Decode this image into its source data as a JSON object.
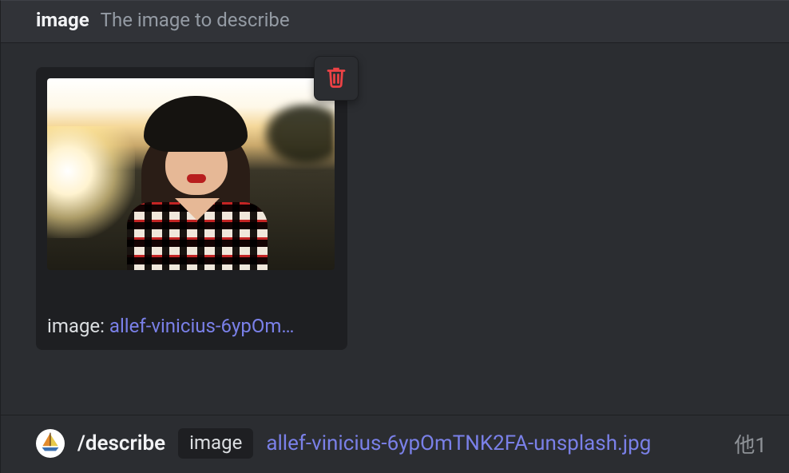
{
  "header": {
    "param_name": "image",
    "param_desc": "The image to describe"
  },
  "attachment": {
    "label_prefix": "image: ",
    "filename_truncated": "allef-vinicius-6ypOm…"
  },
  "input": {
    "command": "/describe",
    "param_chip": "image",
    "file_value": "allef-vinicius-6ypOmTNK2FA-unsplash.jpg",
    "trailing": "他1"
  },
  "icons": {
    "trash": "trash-icon",
    "avatar": "midjourney-avatar"
  }
}
